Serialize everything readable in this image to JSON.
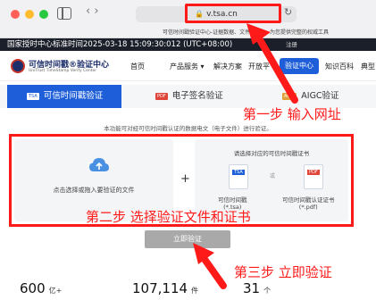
{
  "browser": {
    "url": "v.tsa.cn",
    "tab_title": "可信时间戳验证中心-证据数据、文件认证",
    "tab_title2": "为您提供完整的权威工具"
  },
  "timebar": {
    "text": "国家授时中心标准时间2025-03-18 15:09:30:012 (UTC+08:00)",
    "right_text": "注册"
  },
  "nav": {
    "logo_title": "可信时间戳®验证中心",
    "logo_subtitle": "UniTrust TimeStamp Verify Center",
    "items": [
      "首页",
      "产品服务 ▾",
      "解决方案",
      "开放平",
      "验证中心",
      "知识百科",
      "典型"
    ]
  },
  "tabs": [
    {
      "badge": "TSA",
      "label": "可信时间戳验证"
    },
    {
      "badge": "PDF",
      "label": "电子签名验证"
    },
    {
      "badge": "AIGC",
      "label": "AIGC验证"
    }
  ],
  "description": "本功能可对经可信时间戳认证的数据电文（电子文件）进行验证。",
  "upload": {
    "label": "点击选择或拖入要验证的文件"
  },
  "certificate": {
    "heading": "请选择对应的可信时间戳证书",
    "or_text": "或",
    "tsa_tag": "TSA",
    "pdf_tag": "PDF",
    "tsa_label": "可信时间戳",
    "tsa_ext": "(*.tsa)",
    "pdf_label": "可信时间戳认证证书",
    "pdf_ext": "(*.pdf)"
  },
  "verify_button": "立即验证",
  "stats": [
    {
      "value": "600",
      "unit": "亿+"
    },
    {
      "value": "107,114",
      "unit": "件"
    },
    {
      "value": "31",
      "unit": "个"
    }
  ],
  "annotations": {
    "step1": "第一步 输入网址",
    "step2": "第二步 选择验证文件和证书",
    "step3": "第三步 立即验证"
  },
  "colors": {
    "accent": "#1e5fd9",
    "annotation": "#ff1a1a",
    "timebar": "#1b1f2a"
  }
}
